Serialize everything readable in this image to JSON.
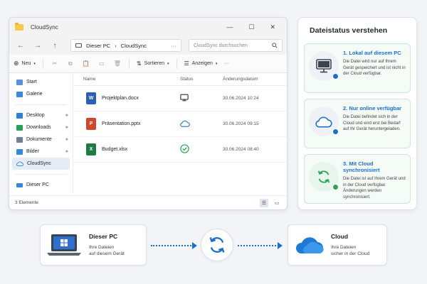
{
  "window": {
    "title": "CloudSync",
    "controls": [
      "—",
      "☐",
      "✕"
    ],
    "nav": [
      "←",
      "→",
      "↑"
    ],
    "breadcrumb": [
      "Dieser PC",
      "CloudSync"
    ],
    "breadcrumb_sep": "›",
    "search_placeholder": "CloudSync durchsuchen",
    "more": "···"
  },
  "toolbar": {
    "new_label": "Neu",
    "sort_label": "Sortieren",
    "view_label": "Anzeigen",
    "more": "···"
  },
  "sidebar": {
    "items": [
      {
        "label": "Start",
        "icon": "home-icon",
        "color": "#5b8fd8"
      },
      {
        "label": "Galerie",
        "icon": "gallery-icon",
        "color": "#3a88d8"
      },
      {
        "label": "Desktop",
        "icon": "desktop-icon",
        "color": "#2e7fd4",
        "pinned": true
      },
      {
        "label": "Downloads",
        "icon": "download-icon",
        "color": "#2f9c5a",
        "pinned": true
      },
      {
        "label": "Dokumente",
        "icon": "documents-icon",
        "color": "#6e7f96",
        "pinned": true
      },
      {
        "label": "Bilder",
        "icon": "pictures-icon",
        "color": "#3a88d8",
        "pinned": true
      },
      {
        "label": "CloudSync",
        "icon": "cloud-icon",
        "color": "#3a88d8",
        "active": true
      },
      {
        "label": "Dieser PC",
        "icon": "pc-icon",
        "color": "#3a88d8"
      }
    ],
    "pin_glyph": "📌"
  },
  "files": {
    "headers": {
      "name": "Name",
      "status": "Status",
      "date": "Änderungsdatum"
    },
    "rows": [
      {
        "name": "Projektplan.docx",
        "letter": "W",
        "color": "#2b5fb4",
        "status": "local",
        "date": "30.06.2024 10:24"
      },
      {
        "name": "Präsentation.pptx",
        "letter": "P",
        "color": "#d0472a",
        "status": "online",
        "date": "30.06.2024 09:15"
      },
      {
        "name": "Budget.xlsx",
        "letter": "X",
        "color": "#1f7a44",
        "status": "synced",
        "date": "30.06.2024 08:40"
      }
    ]
  },
  "statusbar": {
    "count": "3 Elemente"
  },
  "panel": {
    "title": "Dateistatus verstehen",
    "cards": [
      {
        "title": "1. Lokal auf diesem PC",
        "text": "Die Datei wird nur auf Ihrem Gerät gespeichert und ist nicht in der Cloud verfügbar.",
        "icon": "monitor-icon",
        "badge": "#1a6fcc"
      },
      {
        "title": "2. Nur online verfügbar",
        "text": "Die Datei befindet sich in der Cloud und wird erst bei Bedarf auf Ihr Gerät heruntergeladen.",
        "icon": "cloud-outline-icon",
        "badge": "#1a6fcc"
      },
      {
        "title": "3. Mit Cloud synchronisiert",
        "text": "Die Datei ist auf Ihrem Gerät und in der Cloud verfügbar. Änderungen werden synchronisiert.",
        "icon": "sync-icon",
        "badge": "#2fa35a"
      }
    ]
  },
  "diagram": {
    "pc": {
      "title": "Dieser PC",
      "line1": "Ihre Dateien",
      "line2": "auf diesem Gerät"
    },
    "cloud": {
      "title": "Cloud",
      "line1": "Ihre Dateien",
      "line2": "sicher in der Cloud"
    }
  }
}
